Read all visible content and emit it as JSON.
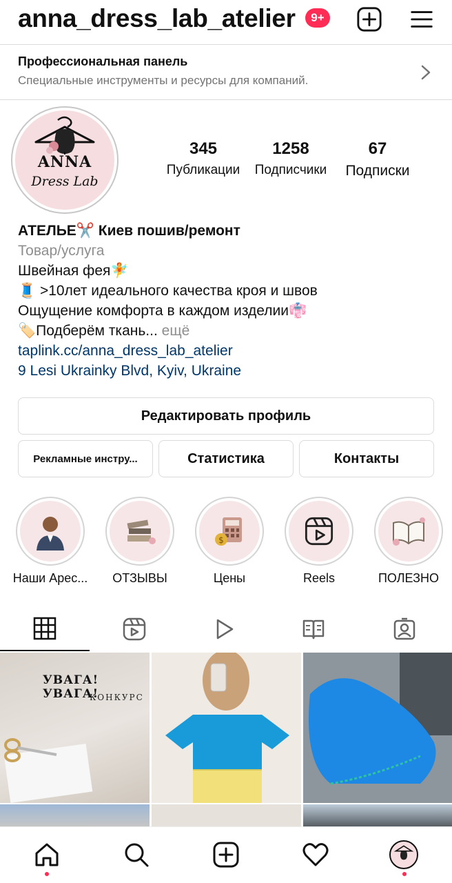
{
  "header": {
    "username": "anna_dress_lab_atelier",
    "notification_badge": "9+",
    "create_icon": "plus-square-icon",
    "menu_icon": "hamburger-menu-icon"
  },
  "pro_panel": {
    "title": "Профессиональная панель",
    "subtitle": "Специальные инструменты и ресурсы для компаний.",
    "chevron_icon": "chevron-right-icon"
  },
  "profile": {
    "avatar_logo_line1": "ANNA",
    "avatar_logo_line2": "Dress Lab",
    "stats": [
      {
        "value": "345",
        "label": "Публикации"
      },
      {
        "value": "1258",
        "label": "Подписчики"
      },
      {
        "value": "67",
        "label": "Подписки"
      }
    ]
  },
  "bio": {
    "name": "АТЕЛЬЕ✂️ Киев пошив/ремонт",
    "category": "Товар/услуга",
    "lines": [
      "Швейная фея🧚",
      "🧵 >10лет идеального качества кроя и швов",
      "Ощущение комфорта в каждом изделии👘",
      "🏷️Подберём ткань..."
    ],
    "more": "ещё",
    "link": "taplink.cc/anna_dress_lab_atelier",
    "address": "9 Lesi Ukrainky Blvd, Kyiv, Ukraine"
  },
  "buttons": {
    "edit_profile": "Редактировать профиль",
    "ad_tools": "Рекламные инстру...",
    "statistics": "Статистика",
    "contacts": "Контакты"
  },
  "highlights": [
    {
      "label": "Наши Арес...",
      "icon": "person-photo-icon"
    },
    {
      "label": "ОТЗЫВЫ",
      "icon": "books-icon"
    },
    {
      "label": "Цены",
      "icon": "calculator-icon"
    },
    {
      "label": "Reels",
      "icon": "reels-icon"
    },
    {
      "label": "ПОЛЕЗНО",
      "icon": "open-book-icon"
    }
  ],
  "tabs": [
    {
      "icon": "grid-icon",
      "active": true
    },
    {
      "icon": "reels-icon",
      "active": false
    },
    {
      "icon": "play-icon",
      "active": false
    },
    {
      "icon": "guide-icon",
      "active": false
    },
    {
      "icon": "tagged-icon",
      "active": false
    }
  ],
  "posts": [
    {
      "title": "УВАГА! УВАГА!",
      "subtitle": "КОНКУРС"
    }
  ],
  "bottom_nav": [
    {
      "icon": "home-icon",
      "dot": true
    },
    {
      "icon": "search-icon",
      "dot": false
    },
    {
      "icon": "plus-square-icon",
      "dot": false
    },
    {
      "icon": "heart-icon",
      "dot": false
    },
    {
      "icon": "profile-avatar-icon",
      "dot": true
    }
  ],
  "colors": {
    "badge": "#ff2d55",
    "link": "#00376b",
    "secondary_text": "#737373",
    "avatar_bg": "#f5dde0"
  }
}
